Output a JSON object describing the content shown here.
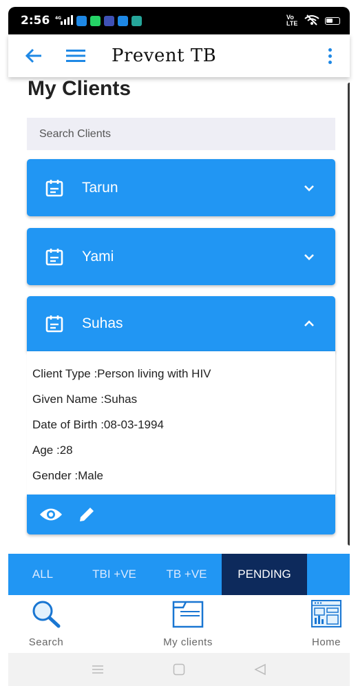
{
  "status_bar": {
    "time": "2:56",
    "signal": "4G",
    "right_label": "Vo LTE"
  },
  "app_bar": {
    "title": "Prevent TB",
    "back_icon": "arrow-left-icon",
    "menu_icon": "hamburger-icon",
    "more_icon": "more-vertical-icon"
  },
  "page": {
    "title": "My Clients",
    "search_placeholder": "Search Clients"
  },
  "clients": [
    {
      "name": "Tarun",
      "expanded": false
    },
    {
      "name": "Yami",
      "expanded": false
    },
    {
      "name": "Suhas",
      "expanded": true
    }
  ],
  "details": {
    "client_type": "Client Type :Person living with HIV",
    "given_name": "Given Name :Suhas",
    "dob": "Date of Birth :08-03-1994",
    "age": "Age :28",
    "gender": "Gender :Male"
  },
  "filter_tabs": [
    {
      "label": "ALL",
      "active": false
    },
    {
      "label": "TBI +VE",
      "active": false
    },
    {
      "label": "TB +VE",
      "active": false
    },
    {
      "label": "PENDING",
      "active": true
    }
  ],
  "bottom_nav": [
    {
      "label": "Search",
      "icon": "magnifier-icon"
    },
    {
      "label": "My clients",
      "icon": "folder-icon"
    },
    {
      "label": "Home",
      "icon": "dashboard-icon"
    }
  ],
  "colors": {
    "primary": "#2196f3",
    "active_tab": "#0d2a5c",
    "search_bg": "#eeeef5"
  }
}
